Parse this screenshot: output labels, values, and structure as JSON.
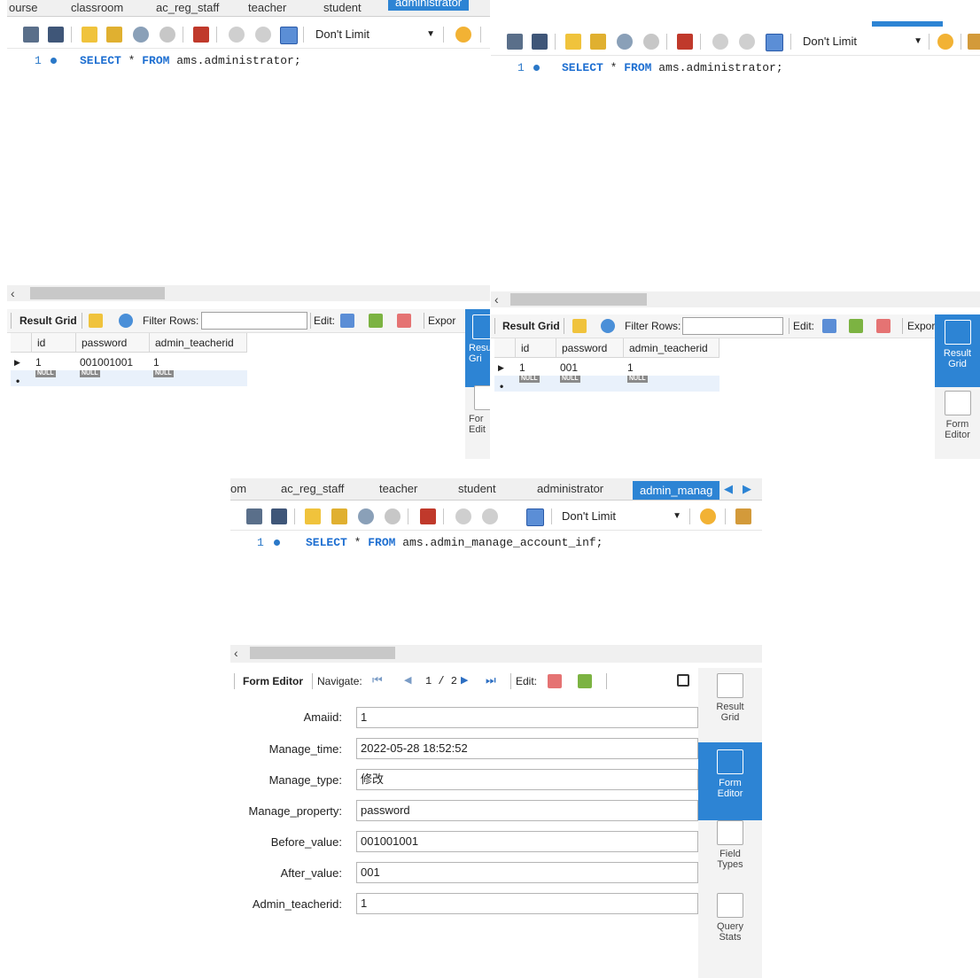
{
  "top_left": {
    "tabs": [
      "ourse",
      "classroom",
      "ac_reg_staff",
      "teacher",
      "student",
      "administrator"
    ],
    "limit": "Don't Limit",
    "line_number": "1",
    "sql": {
      "kw1": "SELECT",
      "star": " * ",
      "kw2": "FROM",
      "table": " ams.administrator;"
    },
    "result_toolbar": {
      "result_grid": "Result Grid",
      "filter_rows": "Filter Rows:",
      "edit": "Edit:",
      "export": "Expor"
    },
    "columns": [
      "id",
      "password",
      "admin_teacherid"
    ],
    "rows": [
      [
        "1",
        "001001001",
        "1"
      ]
    ],
    "null_label": "NULL",
    "side": {
      "result_grid": "Resu\nGri",
      "form_editor": "For\nEdit"
    }
  },
  "top_right": {
    "limit": "Don't Limit",
    "line_number": "1",
    "sql": {
      "kw1": "SELECT",
      "star": " * ",
      "kw2": "FROM",
      "table": " ams.administrator;"
    },
    "result_toolbar": {
      "result_grid": "Result Grid",
      "filter_rows": "Filter Rows:",
      "edit": "Edit:",
      "export": "Expor"
    },
    "columns": [
      "id",
      "password",
      "admin_teacherid"
    ],
    "rows": [
      [
        "1",
        "001",
        "1"
      ]
    ],
    "null_label": "NULL",
    "side": {
      "result_grid": "Result\nGrid",
      "form_editor": "Form\nEditor"
    }
  },
  "bottom": {
    "tabs": [
      "om",
      "ac_reg_staff",
      "teacher",
      "student",
      "administrator",
      "admin_manag"
    ],
    "limit": "Don't Limit",
    "line_number": "1",
    "sql": {
      "kw1": "SELECT",
      "star": " * ",
      "kw2": "FROM",
      "table": " ams.admin_manage_account_inf;"
    },
    "form_toolbar": {
      "form_editor": "Form Editor",
      "navigate": "Navigate:",
      "page": "1 / 2",
      "edit": "Edit:"
    },
    "fields": [
      {
        "label": "Amaiid:",
        "value": "1"
      },
      {
        "label": "Manage_time:",
        "value": "2022-05-28 18:52:52"
      },
      {
        "label": "Manage_type:",
        "value": "修改"
      },
      {
        "label": "Manage_property:",
        "value": "password"
      },
      {
        "label": "Before_value:",
        "value": "001001001"
      },
      {
        "label": "After_value:",
        "value": "001"
      },
      {
        "label": "Admin_teacherid:",
        "value": "1"
      }
    ],
    "side": {
      "result_grid": "Result\nGrid",
      "form_editor": "Form\nEditor",
      "field_types": "Field\nTypes",
      "query_stats": "Query\nStats"
    }
  },
  "colors": {
    "accent": "#2d84d4",
    "keyword": "#1e6fd1"
  }
}
